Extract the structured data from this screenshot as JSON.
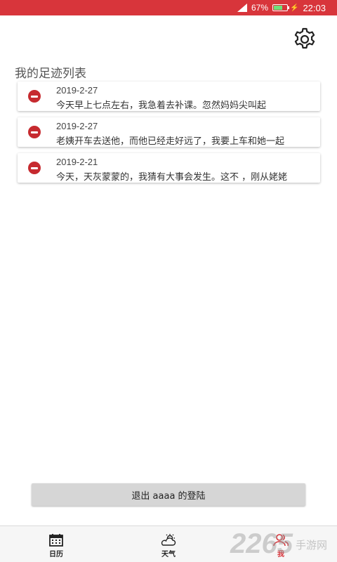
{
  "status_bar": {
    "battery_text": "67%",
    "battery_level": 0.67,
    "time": "22:03",
    "bg_color": "#d8353b"
  },
  "header": {
    "settings_icon": "gear-icon"
  },
  "section_title": "我的足迹列表",
  "footprints": [
    {
      "date": "2019-2-27",
      "text": "今天早上七点左右，我急着去补课。忽然妈妈尖叫起"
    },
    {
      "date": "2019-2-27",
      "text": "老姨开车去送他，而他已经走好远了，我要上车和她一起"
    },
    {
      "date": "2019-2-21",
      "text": "今天，天灰蒙蒙的，我猜有大事会发生。这不 ，刚从姥姥"
    }
  ],
  "logout_label": "退出 aaaa 的登陆",
  "bottom_nav": [
    {
      "label": "日历",
      "icon": "calendar-icon"
    },
    {
      "label": "天气",
      "icon": "weather-icon"
    },
    {
      "label": "我",
      "icon": "user-icon",
      "active": true
    }
  ],
  "watermark": {
    "big": "2265",
    "small": "手游网"
  },
  "colors": {
    "accent": "#d8353b",
    "delete": "#c62a2f"
  }
}
